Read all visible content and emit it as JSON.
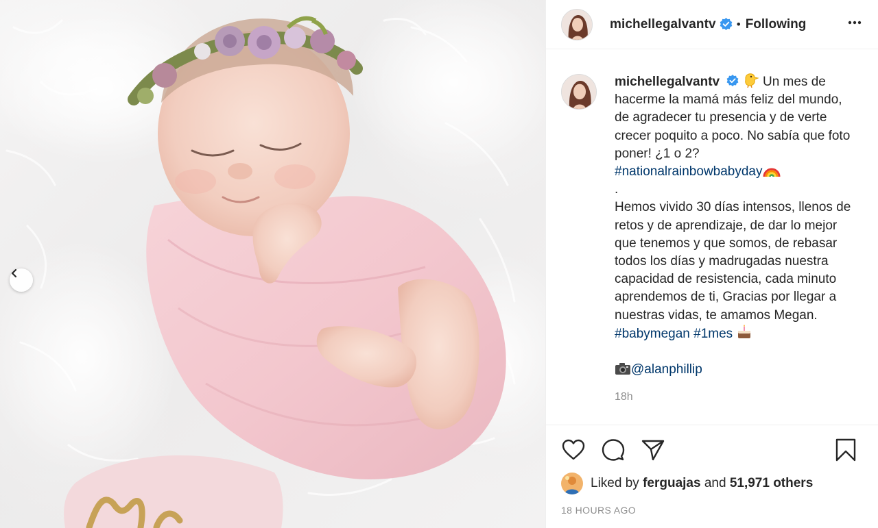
{
  "post": {
    "username": "michellegalvantv",
    "verified": true,
    "follow_state": "Following",
    "separator": "•",
    "more_icon": "more-horizontal-icon"
  },
  "caption": {
    "username": "michellegalvantv",
    "intro": "Un mes de hacerme la mamá más feliz del mundo, de agradecer tu presencia y de verte crecer poquito a poco. No sabía que foto poner! ¿1 o 2?",
    "hashtag_rainbow": "#nationalrainbowbabyday",
    "dot_line": ".",
    "body": "Hemos vivido 30 días intensos, llenos de retos y de aprendizaje, de dar lo mejor que tenemos y que somos, de rebasar todos los días y madrugadas nuestra capacidad de resistencia, cada minuto aprendemos de ti, Gracias por llegar a nuestras vidas, te amamos Megan.",
    "hashtag_baby": "#babymegan",
    "hashtag_month": "#1mes",
    "mention": "@alanphillip",
    "time_short": "18h"
  },
  "actions": {
    "like_icon": "heart-icon",
    "comment_icon": "comment-icon",
    "share_icon": "paper-plane-icon",
    "save_icon": "bookmark-icon"
  },
  "likes": {
    "prefix": "Liked by",
    "liker": "ferguajas",
    "and": "and",
    "count_text": "51,971 others"
  },
  "posted_ago": "18 HOURS AGO",
  "colors": {
    "text": "#262626",
    "secondary": "#8e8e8e",
    "link": "#00376b",
    "verified": "#3897f0",
    "border": "#efefef"
  }
}
